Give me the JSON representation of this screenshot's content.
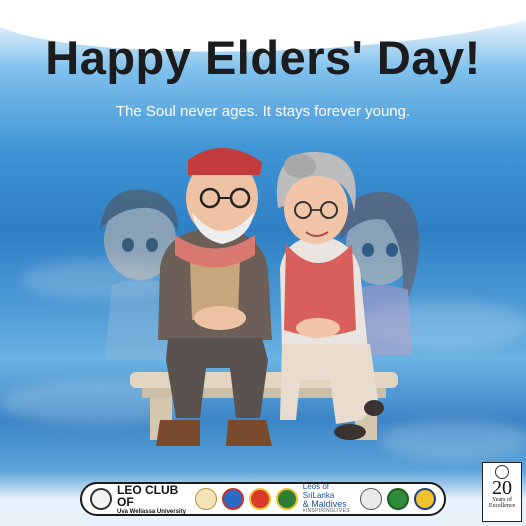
{
  "headline": "Happy Elders' Day!",
  "tagline": "The Soul never ages. It stays forever young.",
  "illustration": {
    "description_icons": [
      "elderly-couple-illustration",
      "child-ghost-left",
      "child-ghost-right",
      "bench"
    ]
  },
  "footer": {
    "leo_club_line1": "LEO CLUB OF",
    "leo_club_line2": "Uva Wellassa University",
    "leos_line1": "Leos of SriLanka",
    "leos_line2": "& Maldives",
    "leos_line3": "#INSPIRINGLIVES"
  },
  "anniversary": {
    "number": "20",
    "line1": "Years of",
    "line2": "Excellence"
  },
  "colors": {
    "headline": "#1c1c1e",
    "tagline": "#ffffff",
    "sky": "#3f95d4"
  }
}
